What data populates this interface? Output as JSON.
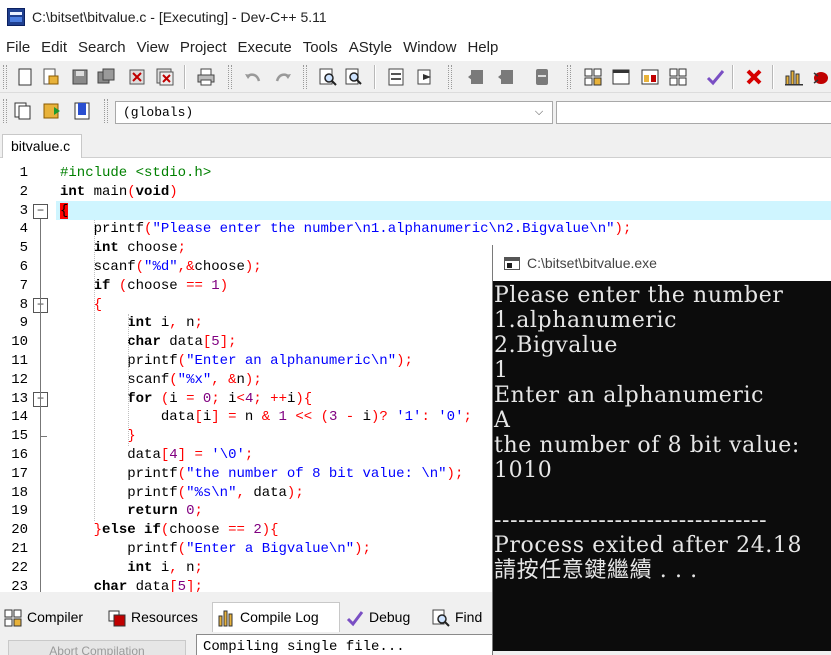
{
  "window": {
    "title": "C:\\bitset\\bitvalue.c - [Executing] - Dev-C++ 5.11"
  },
  "menu": [
    "File",
    "Edit",
    "Search",
    "View",
    "Project",
    "Execute",
    "Tools",
    "AStyle",
    "Window",
    "Help"
  ],
  "toolbar": {
    "scope_value": "(globals)",
    "icons": [
      "new-file-icon",
      "open-icon",
      "save-icon",
      "save-all-icon",
      "close-icon",
      "close-all-icon",
      "print-icon",
      "undo-icon",
      "redo-icon",
      "find-icon",
      "replace-icon",
      "goto-line-icon",
      "bookmark-icon",
      "compile-icon",
      "run-icon",
      "compile-run-icon",
      "rebuild-icon",
      "debug-icon",
      "grid-icon",
      "window-icon",
      "color-icon",
      "layout-icon",
      "check-icon",
      "stop-icon",
      "chart-icon",
      "bug-icon"
    ],
    "icons_row2": [
      "project-icon",
      "add-icon",
      "bookmark-ribbon-icon"
    ]
  },
  "editor": {
    "tab": "bitvalue.c",
    "lines": [
      "#include <stdio.h>",
      "int main(void)",
      "{",
      "    printf(\"Please enter the number\\n1.alphanumeric\\n2.Bigvalue\\n\");",
      "    int choose;",
      "    scanf(\"%d\",&choose);",
      "    if (choose == 1)",
      "    {",
      "        int i, n;",
      "        char data[5];",
      "        printf(\"Enter an alphanumeric\\n\");",
      "        scanf(\"%x\", &n);",
      "        for (i = 0; i<4; ++i){",
      "            data[i] = n & 1 << (3 - i)? '1': '0';",
      "        }",
      "        data[4] = '\\0';",
      "        printf(\"the number of 8 bit value: \\n\");",
      "        printf(\"%s\\n\", data);",
      "        return 0;",
      "    }else if(choose == 2){",
      "        printf(\"Enter a Bigvalue\\n\");",
      "        int i, n;",
      "    char data[5];"
    ],
    "line_numbers": [
      "1",
      "2",
      "3",
      "4",
      "5",
      "6",
      "7",
      "8",
      "9",
      "10",
      "11",
      "12",
      "13",
      "14",
      "15",
      "16",
      "17",
      "18",
      "19",
      "20",
      "21",
      "22",
      "23"
    ],
    "fold_markers": [
      "−",
      "−",
      "−"
    ]
  },
  "bottom_tabs": [
    "Compiler",
    "Resources",
    "Compile Log",
    "Debug",
    "Find"
  ],
  "bottom_icons": [
    "compiler-grid-icon",
    "resources-icon",
    "chart-icon",
    "check-icon",
    "find-icon"
  ],
  "log": {
    "text": "Compiling single file...",
    "abort_label": "Abort Compilation"
  },
  "console": {
    "title": "C:\\bitset\\bitvalue.exe",
    "lines": [
      "Please enter the number",
      "1.alphanumeric",
      "2.Bigvalue",
      "1",
      "Enter an alphanumeric",
      "A",
      "the number of 8 bit value:",
      "1010",
      "",
      "----------------------------------",
      "Process exited after 24.18",
      "請按任意鍵繼續 . . ."
    ]
  }
}
